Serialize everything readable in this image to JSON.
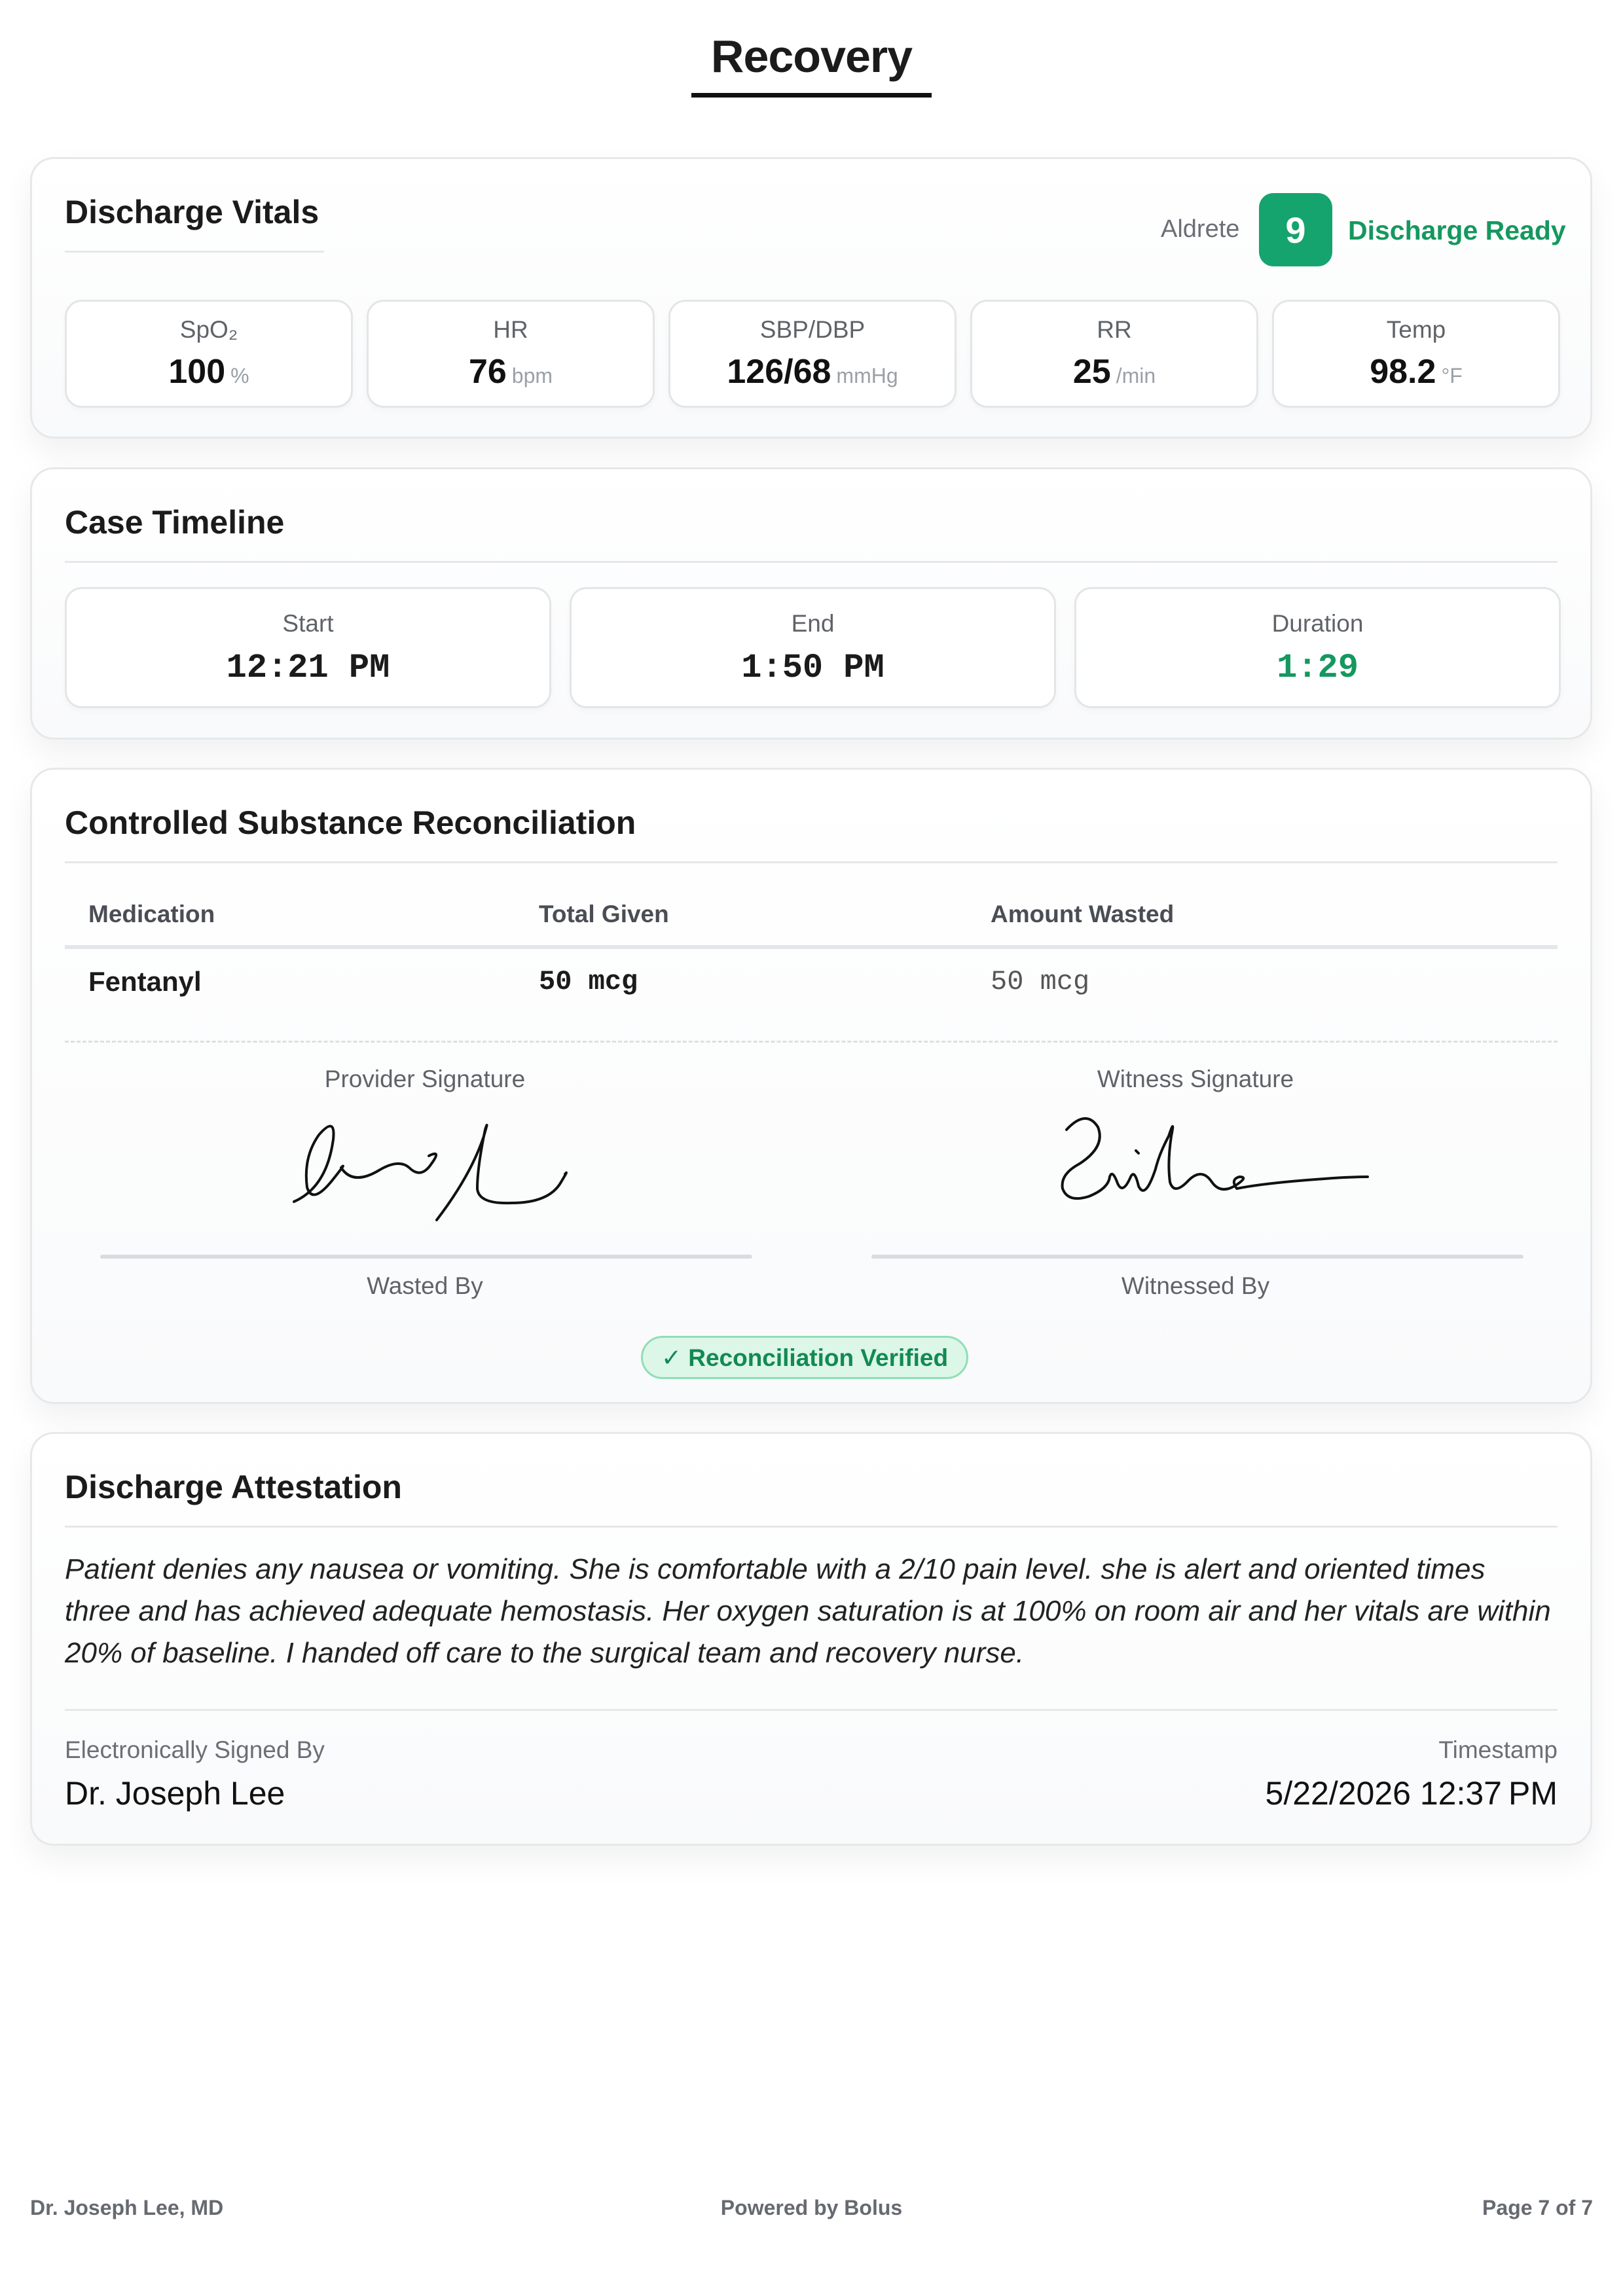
{
  "page": {
    "title": "Recovery"
  },
  "vitals": {
    "title": "Discharge Vitals",
    "aldrete_label": "Aldrete",
    "aldrete_score": "9",
    "status": "Discharge Ready",
    "status_color": "#15985f",
    "items": [
      {
        "label": "SpO₂",
        "value": "100",
        "unit": "%"
      },
      {
        "label": "HR",
        "value": "76",
        "unit": "bpm"
      },
      {
        "label": "SBP/DBP",
        "value": "126/68",
        "unit": "mmHg"
      },
      {
        "label": "RR",
        "value": "25",
        "unit": "/min"
      },
      {
        "label": "Temp",
        "value": "98.2",
        "unit": "°F"
      }
    ]
  },
  "timeline": {
    "title": "Case Timeline",
    "start_label": "Start",
    "start_value": "12:21 PM",
    "end_label": "End",
    "end_value": "1:50 PM",
    "duration_label": "Duration",
    "duration_value": "1:29",
    "duration_color": "#15985f"
  },
  "reconciliation": {
    "title": "Controlled Substance Reconciliation",
    "columns": [
      "Medication",
      "Total Given",
      "Amount Wasted"
    ],
    "rows": [
      {
        "medication": "Fentanyl",
        "total_given": "50 mcg",
        "amount_wasted": "50 mcg"
      }
    ],
    "provider_signature_label": "Provider Signature",
    "witness_signature_label": "Witness Signature",
    "wasted_by_label": "Wasted By",
    "witnessed_by_label": "Witnessed By",
    "verified_text": "✓ Reconciliation Verified"
  },
  "attestation": {
    "title": "Discharge Attestation",
    "text": "Patient denies any nausea or vomiting. She is comfortable with a 2/10 pain level.  she is alert and oriented times three and has achieved adequate hemostasis. Her oxygen saturation is at 100% on room air and her vitals are within 20% of baseline. I handed off care to the surgical team and recovery nurse.",
    "signed_by_label": "Electronically Signed By",
    "signed_by": "Dr. Joseph Lee",
    "timestamp_label": "Timestamp",
    "timestamp": "5/22/2026 12:37 PM"
  },
  "footer": {
    "left": "Dr. Joseph Lee, MD",
    "center": "Powered by Bolus",
    "right": "Page 7 of 7"
  }
}
